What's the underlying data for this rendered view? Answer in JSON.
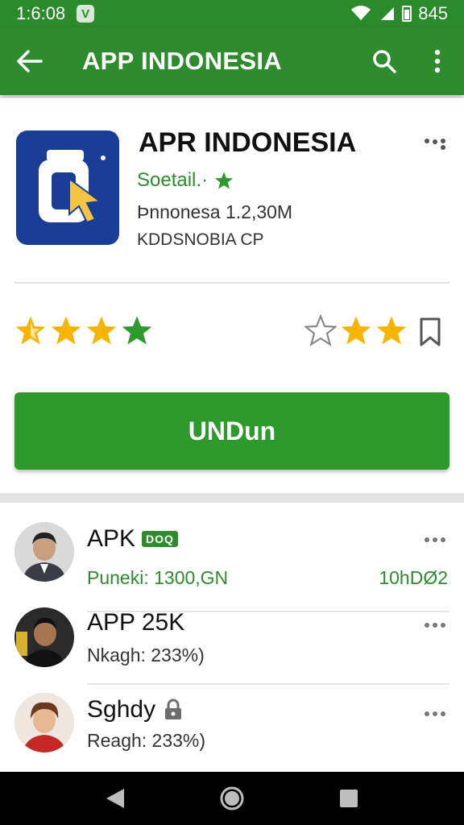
{
  "status": {
    "time": "1:6:08",
    "vpn": "V",
    "battery": "845"
  },
  "appbar": {
    "title": "APP INDONESIA"
  },
  "app": {
    "name": "APR INDONESIA",
    "subtitle": "Soetail.·",
    "meta1": "Þnnonesa 1.2,30M",
    "meta2": "KDDSNOBIA CP"
  },
  "ratings": {
    "left_stars": 4,
    "right_stars": 3
  },
  "install": {
    "label": "UNDun"
  },
  "list": [
    {
      "name": "APK",
      "badge": "DOQ",
      "sub": "Puneki: 1300,GN",
      "right": "10hDØ2",
      "avatar_bg": "#8c8c8c"
    },
    {
      "name": "APP 25K",
      "badge": "",
      "sub": "Nkagh: 233%)",
      "right": "",
      "avatar_bg": "#2a2a2a"
    },
    {
      "name": "Sghdy",
      "badge": "lock",
      "sub": "Reagh: 233%)",
      "right": "",
      "avatar_bg": "#e8d6c8"
    }
  ],
  "colors": {
    "primary": "#2e8b2e",
    "star": "#f4b400",
    "star_green": "#2e9a2e",
    "icon_bg": "#1a3e98"
  }
}
